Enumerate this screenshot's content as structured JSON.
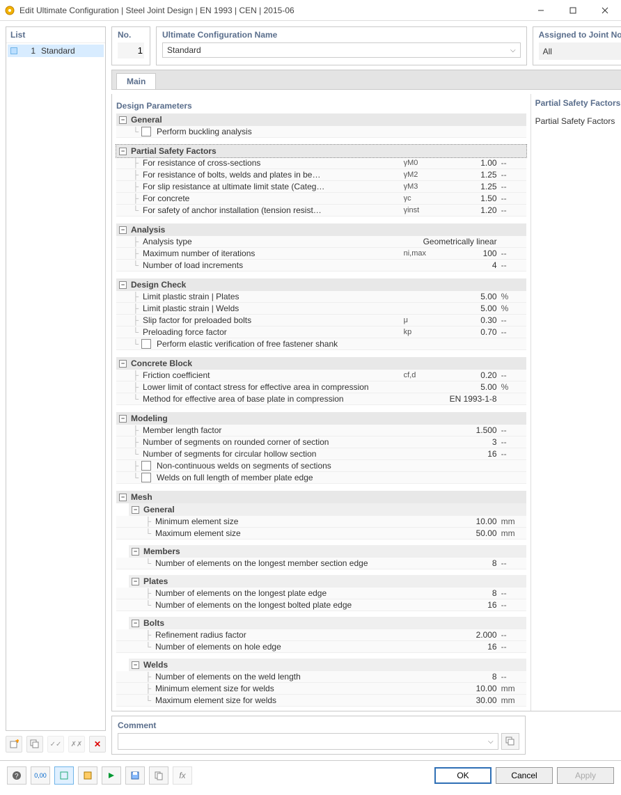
{
  "window": {
    "title": "Edit Ultimate Configuration | Steel Joint Design | EN 1993 | CEN | 2015-06"
  },
  "sidebar": {
    "header": "List",
    "items": [
      {
        "num": "1",
        "name": "Standard"
      }
    ]
  },
  "header": {
    "no_label": "No.",
    "no_value": "1",
    "name_label": "Ultimate Configuration Name",
    "name_value": "Standard",
    "assigned_label": "Assigned to Joint No.",
    "assigned_value": "All"
  },
  "tabs": {
    "main": "Main"
  },
  "info": {
    "title": "Partial Safety Factors",
    "body": "Partial Safety Factors"
  },
  "params_title": "Design Parameters",
  "groups": {
    "general": {
      "title": "General",
      "perform_buckling": "Perform buckling analysis"
    },
    "psf": {
      "title": "Partial Safety Factors",
      "rows": [
        {
          "label": "For resistance of cross-sections",
          "sym": "γM0",
          "val": "1.00",
          "unit": "--"
        },
        {
          "label": "For resistance of bolts, welds and plates in be…",
          "sym": "γM2",
          "val": "1.25",
          "unit": "--"
        },
        {
          "label": "For slip resistance at ultimate limit state (Categ…",
          "sym": "γM3",
          "val": "1.25",
          "unit": "--"
        },
        {
          "label": "For concrete",
          "sym": "γc",
          "val": "1.50",
          "unit": "--"
        },
        {
          "label": "For safety of anchor installation (tension resist…",
          "sym": "γinst",
          "val": "1.20",
          "unit": "--"
        }
      ]
    },
    "analysis": {
      "title": "Analysis",
      "rows": [
        {
          "label": "Analysis type",
          "sym": "",
          "val": "Geometrically linear",
          "unit": "",
          "wide": true
        },
        {
          "label": "Maximum number of iterations",
          "sym": "ni,max",
          "val": "100",
          "unit": "--"
        },
        {
          "label": "Number of load increments",
          "sym": "",
          "val": "4",
          "unit": "--"
        }
      ]
    },
    "design": {
      "title": "Design Check",
      "rows": [
        {
          "label": "Limit plastic strain | Plates",
          "sym": "",
          "val": "5.00",
          "unit": "%"
        },
        {
          "label": "Limit plastic strain | Welds",
          "sym": "",
          "val": "5.00",
          "unit": "%"
        },
        {
          "label": "Slip factor for preloaded bolts",
          "sym": "μ",
          "val": "0.30",
          "unit": "--"
        },
        {
          "label": "Preloading force factor",
          "sym": "kp",
          "val": "0.70",
          "unit": "--"
        }
      ],
      "elastic_verify": "Perform elastic verification of free fastener shank"
    },
    "concrete": {
      "title": "Concrete Block",
      "rows": [
        {
          "label": "Friction coefficient",
          "sym": "cf,d",
          "val": "0.20",
          "unit": "--"
        },
        {
          "label": "Lower limit of contact stress for effective area in compression",
          "sym": "",
          "val": "5.00",
          "unit": "%"
        },
        {
          "label": "Method for effective area of base plate in compression",
          "sym": "",
          "val": "EN 1993-1-8",
          "unit": "",
          "wide": true
        }
      ]
    },
    "modeling": {
      "title": "Modeling",
      "rows": [
        {
          "label": "Member length factor",
          "sym": "",
          "val": "1.500",
          "unit": "--"
        },
        {
          "label": "Number of segments on rounded corner of section",
          "sym": "",
          "val": "3",
          "unit": "--"
        },
        {
          "label": "Number of segments for circular hollow section",
          "sym": "",
          "val": "16",
          "unit": "--"
        }
      ],
      "non_cont_welds": "Non-continuous welds on segments of sections",
      "welds_full_len": "Welds on full length of member plate edge"
    },
    "mesh": {
      "title": "Mesh",
      "general": {
        "title": "General",
        "rows": [
          {
            "label": "Minimum element size",
            "val": "10.00",
            "unit": "mm"
          },
          {
            "label": "Maximum element size",
            "val": "50.00",
            "unit": "mm"
          }
        ]
      },
      "members": {
        "title": "Members",
        "rows": [
          {
            "label": "Number of elements on the longest member section edge",
            "val": "8",
            "unit": "--"
          }
        ]
      },
      "plates": {
        "title": "Plates",
        "rows": [
          {
            "label": "Number of elements on the longest plate edge",
            "val": "8",
            "unit": "--"
          },
          {
            "label": "Number of elements on the longest bolted plate edge",
            "val": "16",
            "unit": "--"
          }
        ]
      },
      "bolts": {
        "title": "Bolts",
        "rows": [
          {
            "label": "Refinement radius factor",
            "val": "2.000",
            "unit": "--"
          },
          {
            "label": "Number of elements on hole edge",
            "val": "16",
            "unit": "--"
          }
        ]
      },
      "welds": {
        "title": "Welds",
        "rows": [
          {
            "label": "Number of elements on the weld length",
            "val": "8",
            "unit": "--"
          },
          {
            "label": "Minimum element size for welds",
            "val": "10.00",
            "unit": "mm"
          },
          {
            "label": "Maximum element size for welds",
            "val": "30.00",
            "unit": "mm"
          }
        ]
      }
    }
  },
  "comment": {
    "label": "Comment"
  },
  "buttons": {
    "ok": "OK",
    "cancel": "Cancel",
    "apply": "Apply"
  }
}
